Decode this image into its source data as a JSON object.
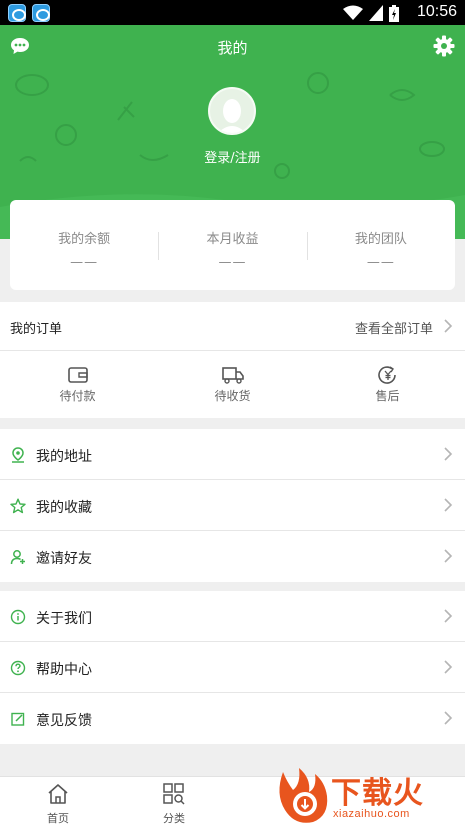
{
  "status_bar": {
    "time": "10:56"
  },
  "header": {
    "title": "我的",
    "login_text": "登录/注册"
  },
  "stats": [
    {
      "label": "我的余额",
      "value": "——"
    },
    {
      "label": "本月收益",
      "value": "——"
    },
    {
      "label": "我的团队",
      "value": "——"
    }
  ],
  "orders": {
    "title": "我的订单",
    "view_all": "查看全部订单",
    "items": [
      {
        "label": "待付款",
        "icon": "wallet-icon"
      },
      {
        "label": "待收货",
        "icon": "truck-icon"
      },
      {
        "label": "售后",
        "icon": "yuan-return-icon"
      }
    ]
  },
  "menu_group_1": [
    {
      "label": "我的地址",
      "icon": "location-pin-icon"
    },
    {
      "label": "我的收藏",
      "icon": "star-icon"
    },
    {
      "label": "邀请好友",
      "icon": "add-user-icon"
    }
  ],
  "menu_group_2": [
    {
      "label": "关于我们",
      "icon": "info-icon"
    },
    {
      "label": "帮助中心",
      "icon": "help-icon"
    },
    {
      "label": "意见反馈",
      "icon": "edit-icon"
    }
  ],
  "tabbar": [
    {
      "label": "首页",
      "icon": "home-icon"
    },
    {
      "label": "分类",
      "icon": "category-icon"
    }
  ],
  "watermark": {
    "brand": "下载火",
    "url": "xiazaihuo.com"
  },
  "colors": {
    "primary": "#3fb24f",
    "accent": "#e8551e"
  }
}
